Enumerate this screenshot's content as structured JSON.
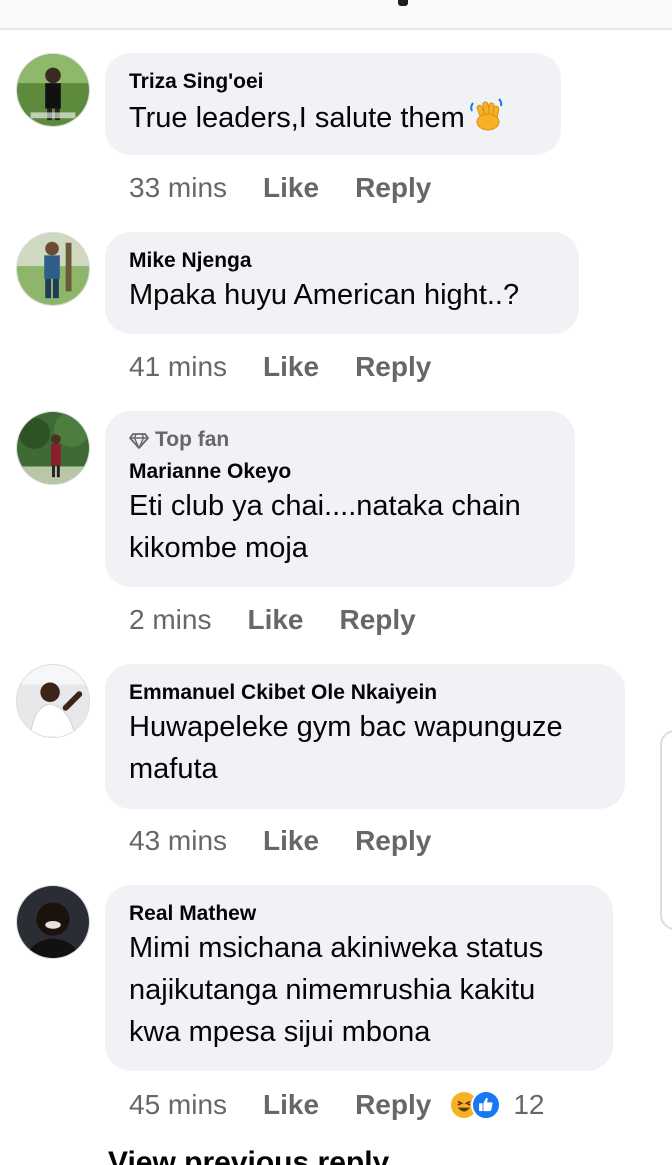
{
  "comments": [
    {
      "author": "Triza Sing'oei",
      "text": "True leaders,I salute them",
      "emoji": "waving-hand",
      "time": "33 mins",
      "like": "Like",
      "reply": "Reply"
    },
    {
      "author": "Mike Njenga",
      "text": "Mpaka huyu American hight..?",
      "time": "41 mins",
      "like": "Like",
      "reply": "Reply"
    },
    {
      "badge": "Top fan",
      "author": "Marianne Okeyo",
      "lines": [
        "Eti club ya chai....nataka chain",
        "kikombe moja"
      ],
      "time": "2 mins",
      "like": "Like",
      "reply": "Reply"
    },
    {
      "author": "Emmanuel Ckibet Ole Nkaiyein",
      "lines": [
        "Huwapeleke gym bac wapunguze",
        "mafuta"
      ],
      "time": "43 mins",
      "like": "Like",
      "reply": "Reply"
    },
    {
      "author": "Real Mathew",
      "lines": [
        "Mimi msichana akiniweka status",
        "najikutanga nimemrushia kakitu",
        "kwa mpesa sijui mbona"
      ],
      "time": "45 mins",
      "like": "Like",
      "reply": "Reply",
      "reactions": [
        "haha",
        "like"
      ],
      "reaction_count": "12"
    }
  ],
  "view_previous": "View previous reply",
  "colors": {
    "bubble": "#f0f2f5",
    "meta": "#65676b",
    "text": "#050505",
    "like_blue": "#1877f2",
    "haha_yellow": "#f7b125"
  }
}
